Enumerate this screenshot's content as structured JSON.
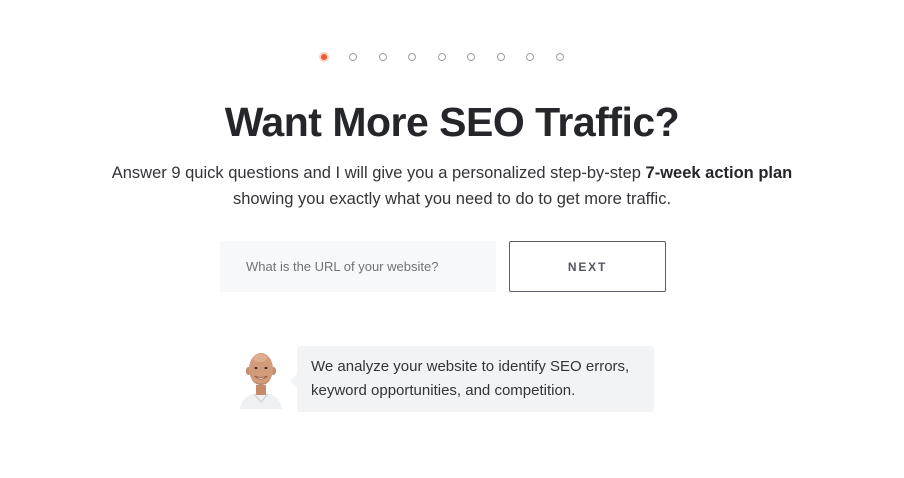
{
  "progress": {
    "total_steps": 9,
    "current_step": 1,
    "active_color": "#f2562c"
  },
  "hero": {
    "title": "Want More SEO Traffic?",
    "subtitle_part1": "Answer 9 quick questions and I will give you a personalized step-by-step ",
    "subtitle_bold": "7-week action plan",
    "subtitle_part2": "showing you exactly what you need to do to get more traffic."
  },
  "form": {
    "url_placeholder": "What is the URL of your website?",
    "url_value": "",
    "next_label": "NEXT"
  },
  "message": {
    "avatar_icon": "person-avatar",
    "line1": "We analyze your website to identify SEO errors,",
    "line2": "keyword opportunities, and competition."
  }
}
